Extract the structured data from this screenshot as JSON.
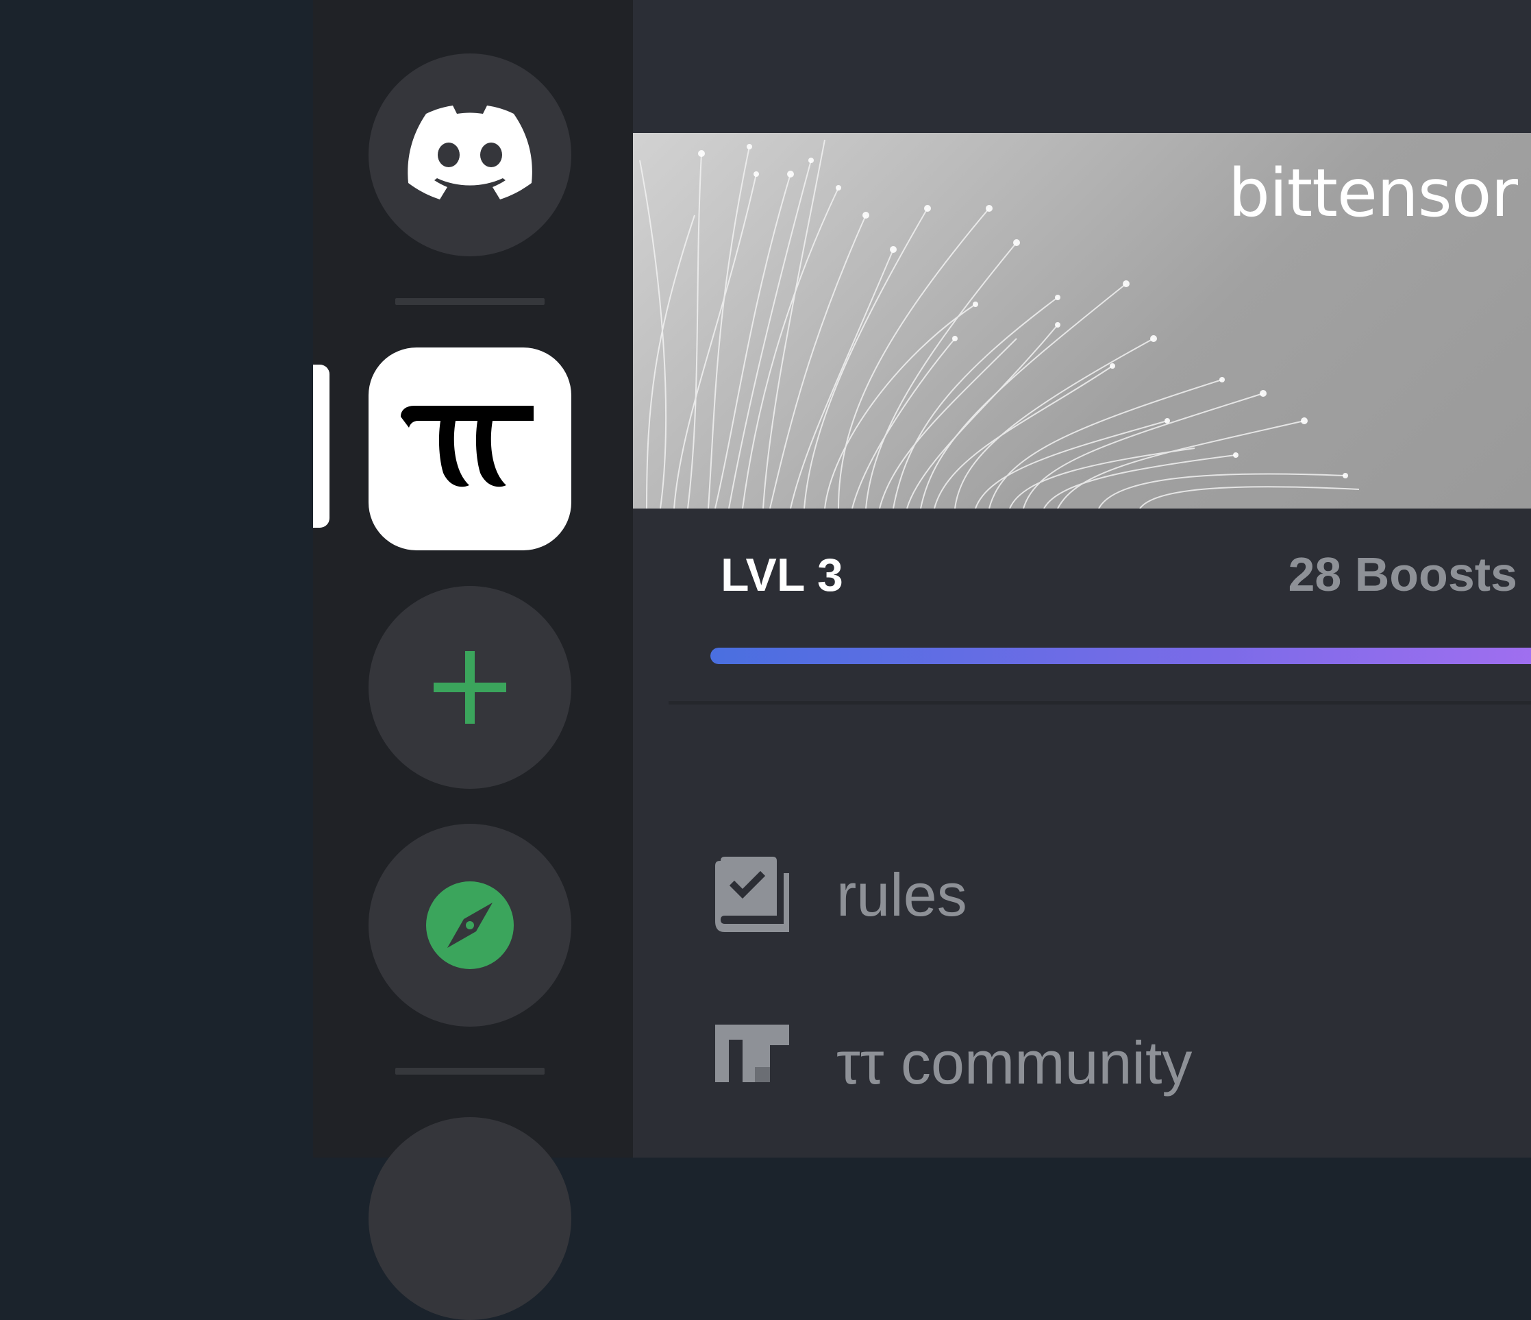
{
  "server_rail": {
    "items": [
      {
        "name": "direct-messages",
        "icon": "discord-logo-icon"
      },
      {
        "name": "bittensor",
        "icon": "bittensor-tau-icon",
        "active": true
      },
      {
        "name": "add-server",
        "icon": "plus-icon"
      },
      {
        "name": "explore",
        "icon": "compass-icon"
      }
    ]
  },
  "banner": {
    "brand_text": "bittensor"
  },
  "boost": {
    "level_label": "LVL 3",
    "boosts_label": "28 Boosts",
    "progress_fraction": 1.0
  },
  "channels": [
    {
      "name": "rules",
      "icon": "rules-book-icon"
    },
    {
      "name": "ττ community",
      "icon": "community-tau-icon"
    }
  ],
  "colors": {
    "rail_bg": "#202226",
    "main_bg": "#2c2e35",
    "button_bg": "#35363b",
    "green": "#3ba55c",
    "progress_start": "#4a6fe0",
    "progress_end": "#a26ff0",
    "muted_text": "#8e9197"
  }
}
